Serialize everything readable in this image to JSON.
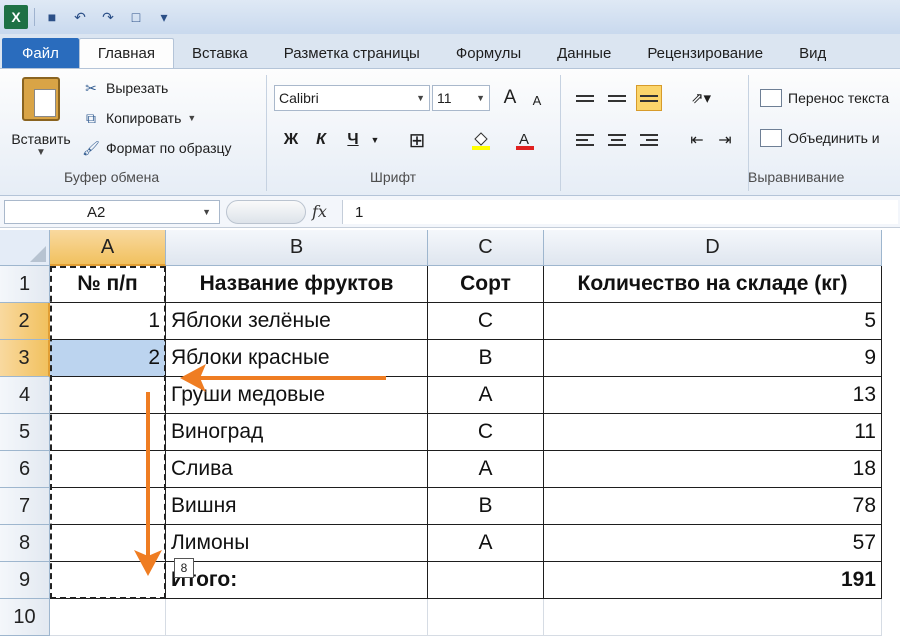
{
  "qat": {
    "app_icon_letter": "X",
    "icons": [
      "save-icon",
      "undo-icon",
      "redo-icon",
      "new-doc-icon",
      "customize-icon"
    ]
  },
  "tabs": [
    {
      "label": "Файл",
      "key": "file"
    },
    {
      "label": "Главная",
      "key": "home",
      "active": true
    },
    {
      "label": "Вставка",
      "key": "insert"
    },
    {
      "label": "Разметка страницы",
      "key": "layout"
    },
    {
      "label": "Формулы",
      "key": "formulas"
    },
    {
      "label": "Данные",
      "key": "data"
    },
    {
      "label": "Рецензирование",
      "key": "review"
    },
    {
      "label": "Вид",
      "key": "view"
    }
  ],
  "ribbon": {
    "clipboard": {
      "paste_label": "Вставить",
      "cut_label": "Вырезать",
      "copy_label": "Копировать",
      "format_painter_label": "Формат по образцу",
      "group_label": "Буфер обмена"
    },
    "font": {
      "font_name": "Calibri",
      "font_size": "11",
      "bold": "Ж",
      "italic": "К",
      "underline": "Ч",
      "grow": "A",
      "shrink": "A",
      "group_label": "Шрифт"
    },
    "alignment": {
      "wrap_text_label": "Перенос текста",
      "merge_label": "Объединить и",
      "group_label": "Выравнивание"
    }
  },
  "formula_bar": {
    "name_box": "A2",
    "fx": "fx",
    "value": "1"
  },
  "grid": {
    "columns": [
      {
        "label": "A",
        "selected": true
      },
      {
        "label": "B",
        "selected": false
      },
      {
        "label": "C",
        "selected": false
      },
      {
        "label": "D",
        "selected": false
      }
    ],
    "rows": [
      {
        "num": "1",
        "a": "№ п/п",
        "b": "Название фруктов",
        "c": "Сорт",
        "d": "Количество на складе (кг)"
      },
      {
        "num": "2",
        "a": "1",
        "b": "Яблоки зелёные",
        "c": "С",
        "d": "5"
      },
      {
        "num": "3",
        "a": "2",
        "b": "Яблоки красные",
        "c": "В",
        "d": "9"
      },
      {
        "num": "4",
        "a": "",
        "b": "Груши медовые",
        "c": "А",
        "d": "13"
      },
      {
        "num": "5",
        "a": "",
        "b": "Виноград",
        "c": "С",
        "d": "11"
      },
      {
        "num": "6",
        "a": "",
        "b": "Слива",
        "c": "А",
        "d": "18"
      },
      {
        "num": "7",
        "a": "",
        "b": "Вишня",
        "c": "В",
        "d": "78"
      },
      {
        "num": "8",
        "a": "",
        "b": "Лимоны",
        "c": "А",
        "d": "57"
      },
      {
        "num": "9",
        "a": "",
        "b": "Итого:",
        "c": "",
        "d": "191"
      },
      {
        "num": "10",
        "a": "",
        "b": "",
        "c": "",
        "d": ""
      }
    ],
    "selected_rows": [
      "2",
      "3"
    ],
    "fill_tooltip": "8"
  },
  "colors": {
    "accent": "#2a6cbd",
    "selection_header": "#f1c15f",
    "selection_fill": "#bcd4ef",
    "annotation_arrow": "#ef7d22"
  }
}
